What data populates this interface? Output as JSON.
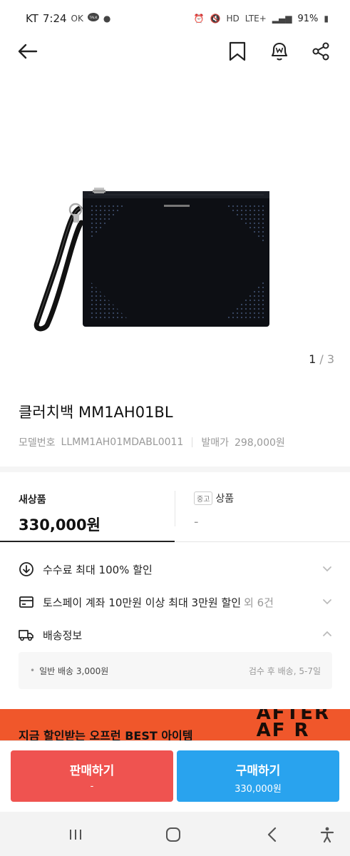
{
  "status_bar": {
    "carrier": "KT",
    "time": "7:24",
    "left_icons": "OK",
    "talk": "TALK",
    "network": "LTE+",
    "battery": "91%"
  },
  "app_bar": {
    "back_icon": "arrow-left-icon",
    "bookmark_icon": "bookmark-icon",
    "notify_icon": "bell-w-icon",
    "share_icon": "share-icon"
  },
  "product": {
    "image_index": "1",
    "image_separator": " / ",
    "image_total": "3",
    "title": "클러치백 MM1AH01BL",
    "model_label": "모델번호",
    "model_value": "LLMM1AH01MDABL0011",
    "release_label": "발매가",
    "release_value": "298,000원"
  },
  "price_tabs": {
    "new": {
      "label": "새상품",
      "price": "330,000원"
    },
    "used": {
      "badge": "중고",
      "label": "상품",
      "price": "-"
    }
  },
  "benefits": [
    {
      "icon": "coin-down-icon",
      "text": "수수료 최대 100% 할인",
      "extra": ""
    },
    {
      "icon": "card-icon",
      "text": "토스페이 계좌 10만원 이상 최대 3만원 할인",
      "extra": "외 6건"
    },
    {
      "icon": "truck-icon",
      "text": "배송정보",
      "extra": ""
    }
  ],
  "shipping": {
    "bullet": "•",
    "text": "일반 배송 3,000원",
    "right": "검수 후 배송, 5-7일"
  },
  "banner": {
    "text": "지금 할인받는 오프런 BEST 아이템",
    "art_line1": "AFTER",
    "art_line2": "AF  R"
  },
  "actions": {
    "sell_label": "판매하기",
    "sell_sub": "-",
    "buy_label": "구매하기",
    "buy_sub": "330,000원"
  },
  "colors": {
    "sell": "#ef5350",
    "buy": "#29a3ee",
    "banner": "#f0572b"
  }
}
